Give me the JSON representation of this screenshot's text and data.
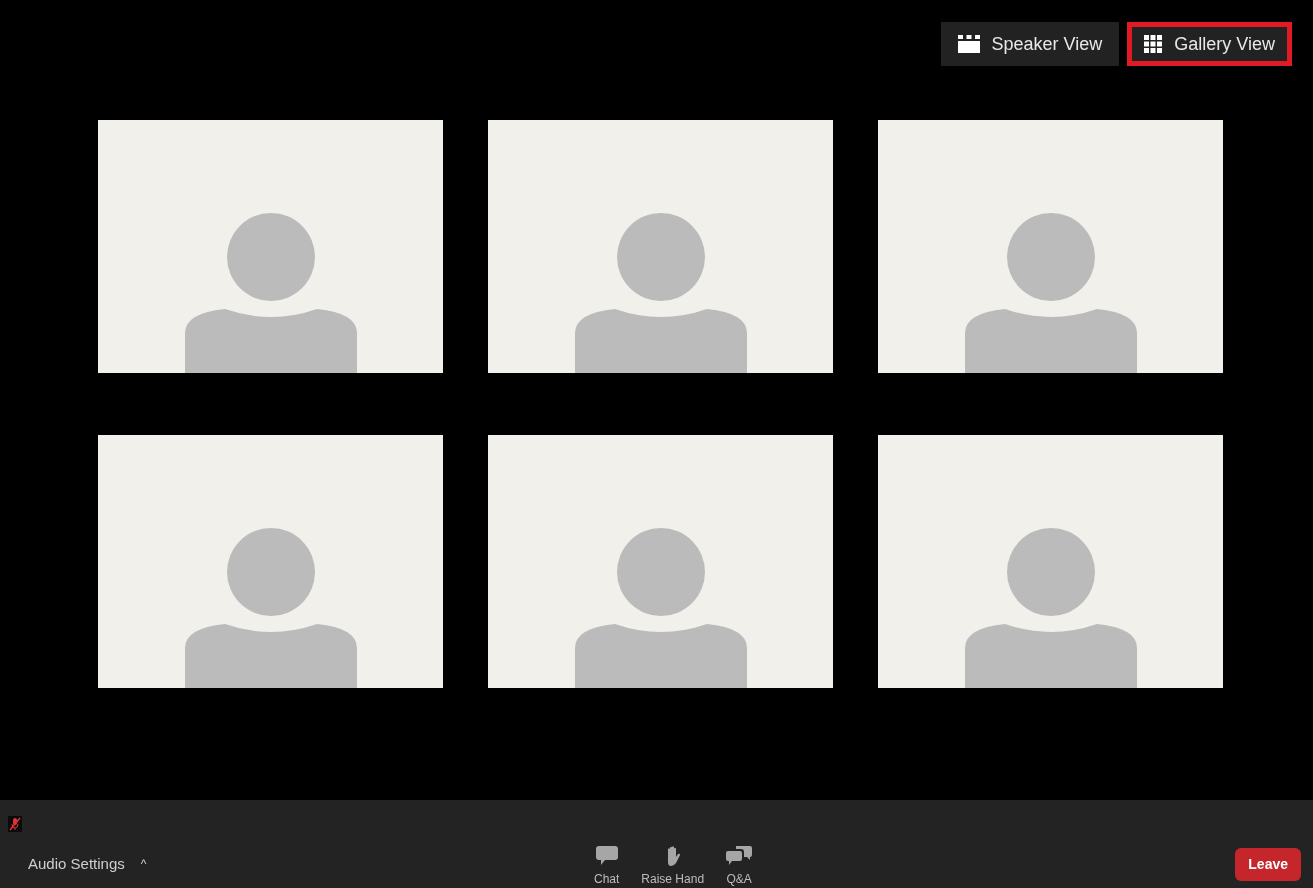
{
  "view_switch": [
    {
      "kind": "speaker",
      "label": "Speaker View",
      "selected": false
    },
    {
      "kind": "gallery",
      "label": "Gallery View",
      "selected": true
    }
  ],
  "participants": [
    {
      "kind": "avatar"
    },
    {
      "kind": "avatar"
    },
    {
      "kind": "avatar"
    },
    {
      "kind": "avatar"
    },
    {
      "kind": "avatar"
    },
    {
      "kind": "avatar"
    }
  ],
  "toolbar": {
    "mic_muted": true,
    "audio_settings": {
      "label": "Audio Settings",
      "caret": "^"
    },
    "actions": [
      {
        "kind": "chat",
        "label": "Chat"
      },
      {
        "kind": "hand",
        "label": "Raise Hand"
      },
      {
        "kind": "qa",
        "label": "Q&A"
      }
    ],
    "leave": "Leave"
  }
}
